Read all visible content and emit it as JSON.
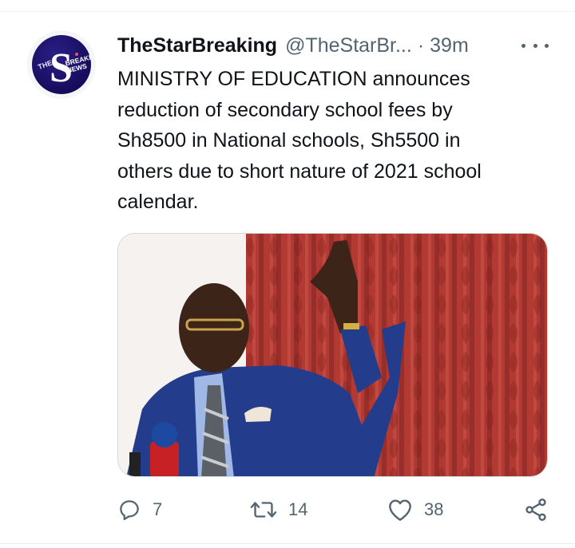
{
  "tweet": {
    "display_name": "TheStarBreaking",
    "handle": "@TheStarBr...",
    "separator": "·",
    "time": "39m",
    "text_lines": [
      "MINISTRY OF EDUCATION announces",
      "reduction of secondary school fees by",
      "Sh8500 in National schools, Sh5500 in",
      "others due to short nature of 2021 school",
      "calendar."
    ]
  },
  "avatar": {
    "text_the": "THE",
    "text_letter": "S",
    "text_breaking": "BREAKING",
    "text_news": "NEWS",
    "colors": {
      "bg": "#1b1170",
      "letter": "#ffffff",
      "accent": "#e8e6f5"
    }
  },
  "media": {
    "description_icon": "photo-image",
    "curtain_color": "#b7352f",
    "suit_color": "#243d8f"
  },
  "actions": {
    "reply_count": "7",
    "retweet_count": "14",
    "like_count": "38",
    "icons": [
      "reply-icon",
      "retweet-icon",
      "like-icon",
      "share-icon"
    ]
  },
  "colors": {
    "text_primary": "#0f1419",
    "text_secondary": "#536471",
    "border": "#cfd9de"
  }
}
